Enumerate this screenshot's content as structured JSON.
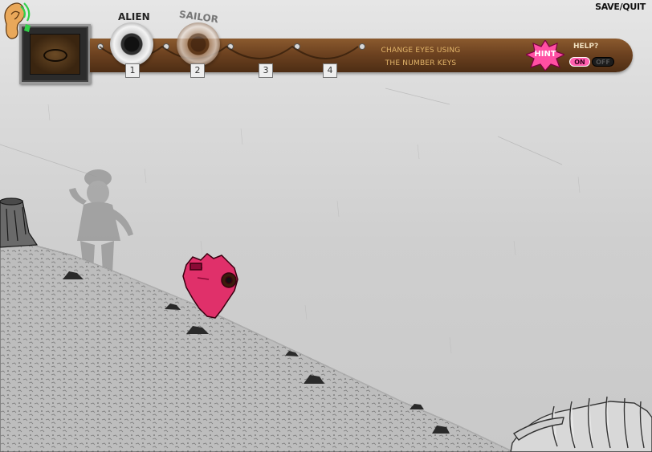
{
  "menu": {
    "save_quit": "SAVE/QUIT"
  },
  "eyes": [
    {
      "key": "1",
      "name": "ALIEN"
    },
    {
      "key": "2",
      "name": "SAILOR"
    },
    {
      "key": "3",
      "name": ""
    },
    {
      "key": "4",
      "name": ""
    }
  ],
  "hint_bar": {
    "instruction_line1": "CHANGE EYES USING",
    "instruction_line2": "THE NUMBER KEYS",
    "hint_label": "HINT",
    "help_label": "HELP?",
    "help_on": "ON",
    "help_off": "OFF",
    "help_selected": "ON"
  },
  "colors": {
    "bar_brown": "#6d4220",
    "hint_pink": "#ff4fa3",
    "instruction_text": "#e2b56a",
    "creature_red": "#e0306a"
  }
}
